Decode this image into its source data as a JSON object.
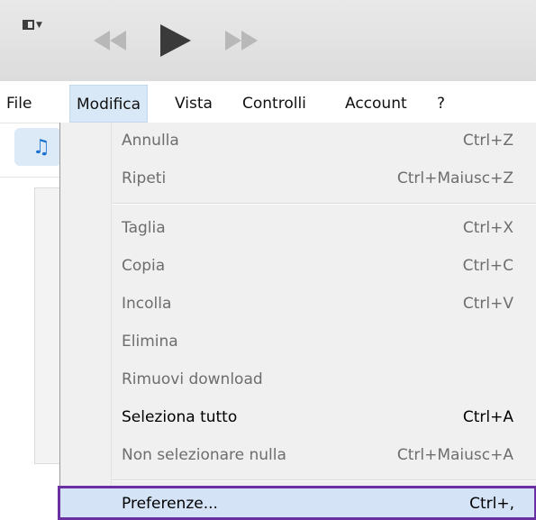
{
  "menubar": {
    "items": [
      {
        "label": "File"
      },
      {
        "label": "Modifica"
      },
      {
        "label": "Vista"
      },
      {
        "label": "Controlli"
      },
      {
        "label": "Account"
      },
      {
        "label": "?"
      }
    ]
  },
  "edit_menu": {
    "items": [
      {
        "label": "Annulla",
        "shortcut": "Ctrl+Z",
        "enabled": false
      },
      {
        "label": "Ripeti",
        "shortcut": "Ctrl+Maiusc+Z",
        "enabled": false
      },
      {
        "label": "Taglia",
        "shortcut": "Ctrl+X",
        "enabled": false
      },
      {
        "label": "Copia",
        "shortcut": "Ctrl+C",
        "enabled": false
      },
      {
        "label": "Incolla",
        "shortcut": "Ctrl+V",
        "enabled": false
      },
      {
        "label": "Elimina",
        "shortcut": "",
        "enabled": false
      },
      {
        "label": "Rimuovi download",
        "shortcut": "",
        "enabled": false
      },
      {
        "label": "Seleziona tutto",
        "shortcut": "Ctrl+A",
        "enabled": true
      },
      {
        "label": "Non selezionare nulla",
        "shortcut": "Ctrl+Maiusc+A",
        "enabled": false
      },
      {
        "label": "Preferenze...",
        "shortcut": "Ctrl+,",
        "enabled": true,
        "highlighted": true
      }
    ]
  },
  "toolbar": {
    "icons": [
      "sidebar-toggle-icon",
      "rewind-icon",
      "play-icon",
      "fast-forward-icon"
    ]
  },
  "library": {
    "icons": [
      "music-note-icon"
    ]
  },
  "colors": {
    "menu_active_bg": "#d9e8f7",
    "highlight_border": "#6a2fa1",
    "disabled_text": "#6d6d6d",
    "accent": "#1a73d1"
  }
}
